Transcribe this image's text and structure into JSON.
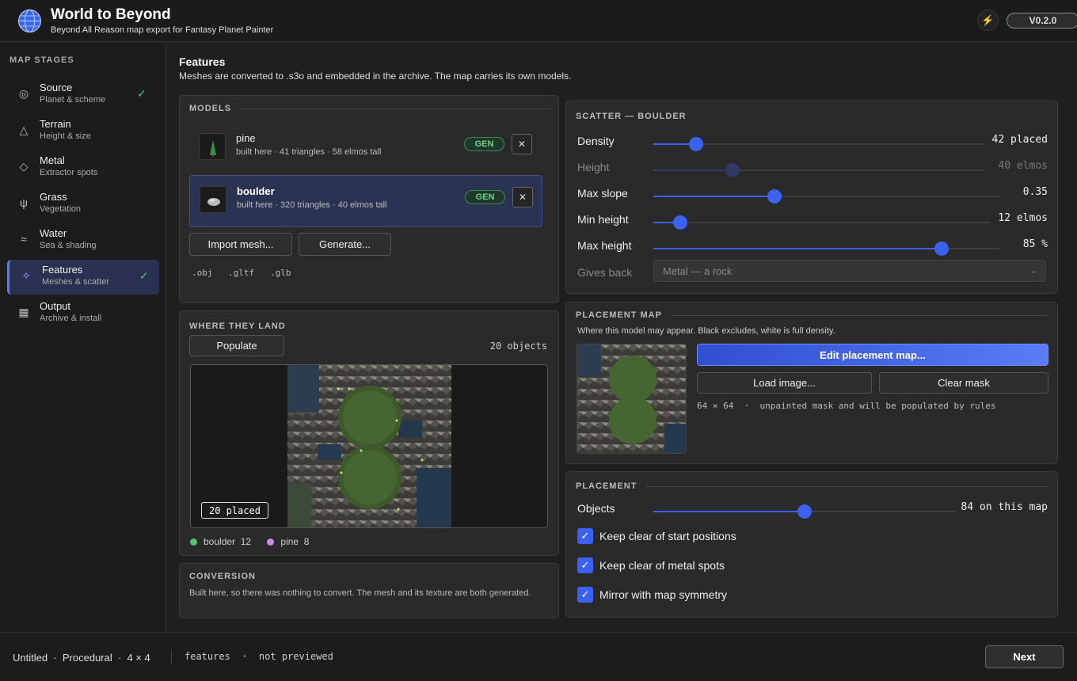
{
  "header": {
    "title": "World to Beyond",
    "subtitle": "Beyond All Reason map export for Fantasy Planet Painter",
    "version": "V0.2.0",
    "bolt_icon": "lightning-icon"
  },
  "sidebar": {
    "heading": "MAP STAGES",
    "items": [
      {
        "title": "Source",
        "sub": "Planet & scheme",
        "icon": "target-icon",
        "glyph": "◎",
        "done": true,
        "active": false
      },
      {
        "title": "Terrain",
        "sub": "Height & size",
        "icon": "triangle-icon",
        "glyph": "△",
        "done": false,
        "active": false
      },
      {
        "title": "Metal",
        "sub": "Extractor spots",
        "icon": "diamond-icon",
        "glyph": "◇",
        "done": false,
        "active": false
      },
      {
        "title": "Grass",
        "sub": "Vegetation",
        "icon": "sprout-icon",
        "glyph": "ψ",
        "done": false,
        "active": false
      },
      {
        "title": "Water",
        "sub": "Sea & shading",
        "icon": "waves-icon",
        "glyph": "≈",
        "done": false,
        "active": false
      },
      {
        "title": "Features",
        "sub": "Meshes & scatter",
        "icon": "sparkle-icon",
        "glyph": "✧",
        "done": true,
        "active": true
      },
      {
        "title": "Output",
        "sub": "Archive & install",
        "icon": "grid-icon",
        "glyph": "▦",
        "done": false,
        "active": false
      }
    ],
    "check_glyph": "✓"
  },
  "page": {
    "title": "Features",
    "subtitle": "Meshes are converted to .s3o and embedded in the archive. The map carries its own models."
  },
  "models": {
    "heading": "MODELS",
    "items": [
      {
        "name": "pine",
        "meta": "built here · 41 triangles · 58 elmos tall",
        "badge": "GEN"
      },
      {
        "name": "boulder",
        "meta": "built here · 320 triangles · 40 elmos tall",
        "badge": "GEN"
      }
    ],
    "remove_glyph": "✕",
    "import_label": "Import mesh...",
    "generate_label": "Generate...",
    "extensions": [
      ".obj",
      ".gltf",
      ".glb"
    ]
  },
  "land": {
    "heading": "WHERE THEY LAND",
    "populate_label": "Populate",
    "count": "20 objects",
    "placed_badge": "20 placed",
    "legend": [
      {
        "name": "boulder",
        "count": "12",
        "color": "#56c271"
      },
      {
        "name": "pine",
        "count": "8",
        "color": "#c98ce3"
      }
    ]
  },
  "conversion": {
    "heading": "CONVERSION",
    "text": "Built here, so there was nothing to convert. The mesh and its texture are both generated."
  },
  "scatter": {
    "heading": "SCATTER — BOULDER",
    "sliders": [
      {
        "label": "Density",
        "value": "42 placed",
        "fraction": 0.13,
        "disabled": false
      },
      {
        "label": "Height",
        "value": "40 elmos",
        "fraction": 0.24,
        "disabled": true
      },
      {
        "label": "Max slope",
        "value": "0.35",
        "fraction": 0.35,
        "disabled": false
      },
      {
        "label": "Min height",
        "value": "12 elmos",
        "fraction": 0.08,
        "disabled": false
      },
      {
        "label": "Max height",
        "value": "85 %",
        "fraction": 0.83,
        "disabled": false
      }
    ],
    "gives_back_label": "Gives back",
    "gives_back_value": "Metal — a rock",
    "chevron_glyph": "⌄"
  },
  "placement_map": {
    "heading": "PLACEMENT MAP",
    "subtitle": "Where this model may appear. Black excludes, white is full density.",
    "edit_label": "Edit placement map...",
    "load_label": "Load image...",
    "clear_label": "Clear mask",
    "info": "64 × 64  ·  unpainted mask and will be populated by rules"
  },
  "placement": {
    "heading": "PLACEMENT",
    "objects_label": "Objects",
    "objects_value": "84 on this map",
    "objects_fraction": 0.5,
    "checks": [
      {
        "label": "Keep clear of start positions",
        "checked": true
      },
      {
        "label": "Keep clear of metal spots",
        "checked": true
      },
      {
        "label": "Mirror with map symmetry",
        "checked": true
      }
    ],
    "check_glyph": "✓"
  },
  "footer": {
    "left": "Untitled  ·  Procedural  ·  4 × 4",
    "mid": "features  ·  not previewed",
    "next_label": "Next"
  }
}
